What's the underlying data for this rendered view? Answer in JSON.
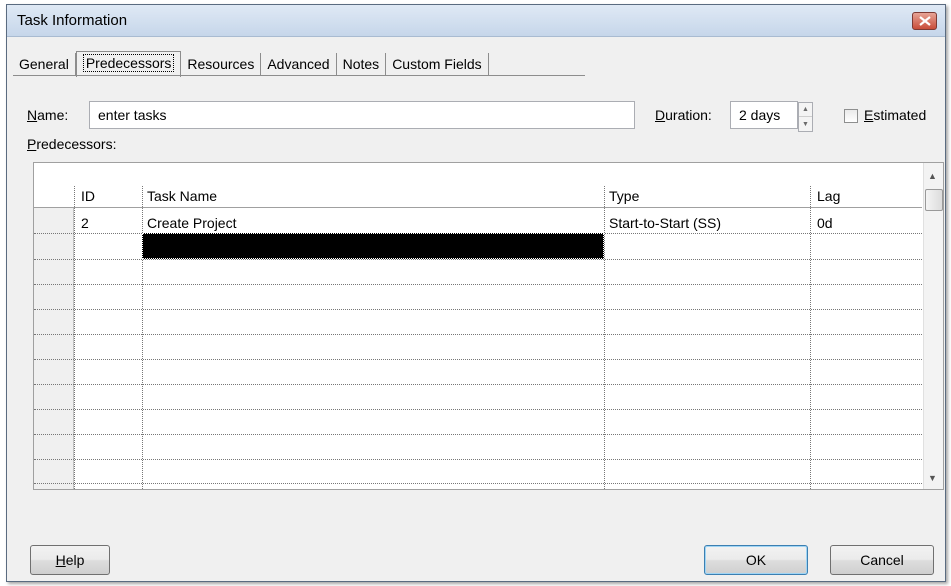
{
  "window": {
    "title": "Task Information"
  },
  "tabs": [
    {
      "label": "General",
      "active": false
    },
    {
      "label": "Predecessors",
      "active": true
    },
    {
      "label": "Resources",
      "active": false
    },
    {
      "label": "Advanced",
      "active": false
    },
    {
      "label": "Notes",
      "active": false
    },
    {
      "label": "Custom Fields",
      "active": false
    }
  ],
  "form": {
    "name_label_hotkey": "N",
    "name_label_rest": "ame:",
    "name_value": "enter tasks",
    "duration_label_hotkey": "D",
    "duration_label_rest": "uration:",
    "duration_value": "2 days",
    "estimated_label_hotkey": "E",
    "estimated_label_rest": "stimated",
    "estimated_checked": false,
    "predecessors_label_hotkey": "P",
    "predecessors_label_rest": "redecessors:"
  },
  "grid": {
    "columns": [
      "ID",
      "Task Name",
      "Type",
      "Lag"
    ],
    "rows": [
      {
        "id": "2",
        "task_name": "Create Project",
        "type": "Start-to-Start (SS)",
        "lag": "0d"
      }
    ]
  },
  "buttons": {
    "help_hotkey": "H",
    "help_rest": "elp",
    "ok": "OK",
    "cancel": "Cancel"
  },
  "icons": {
    "close": "close-icon",
    "spin_up": "spin-up-arrow-icon",
    "spin_down": "spin-down-arrow-icon",
    "scroll_up": "scroll-up-arrow-icon",
    "scroll_down": "scroll-down-arrow-icon"
  }
}
